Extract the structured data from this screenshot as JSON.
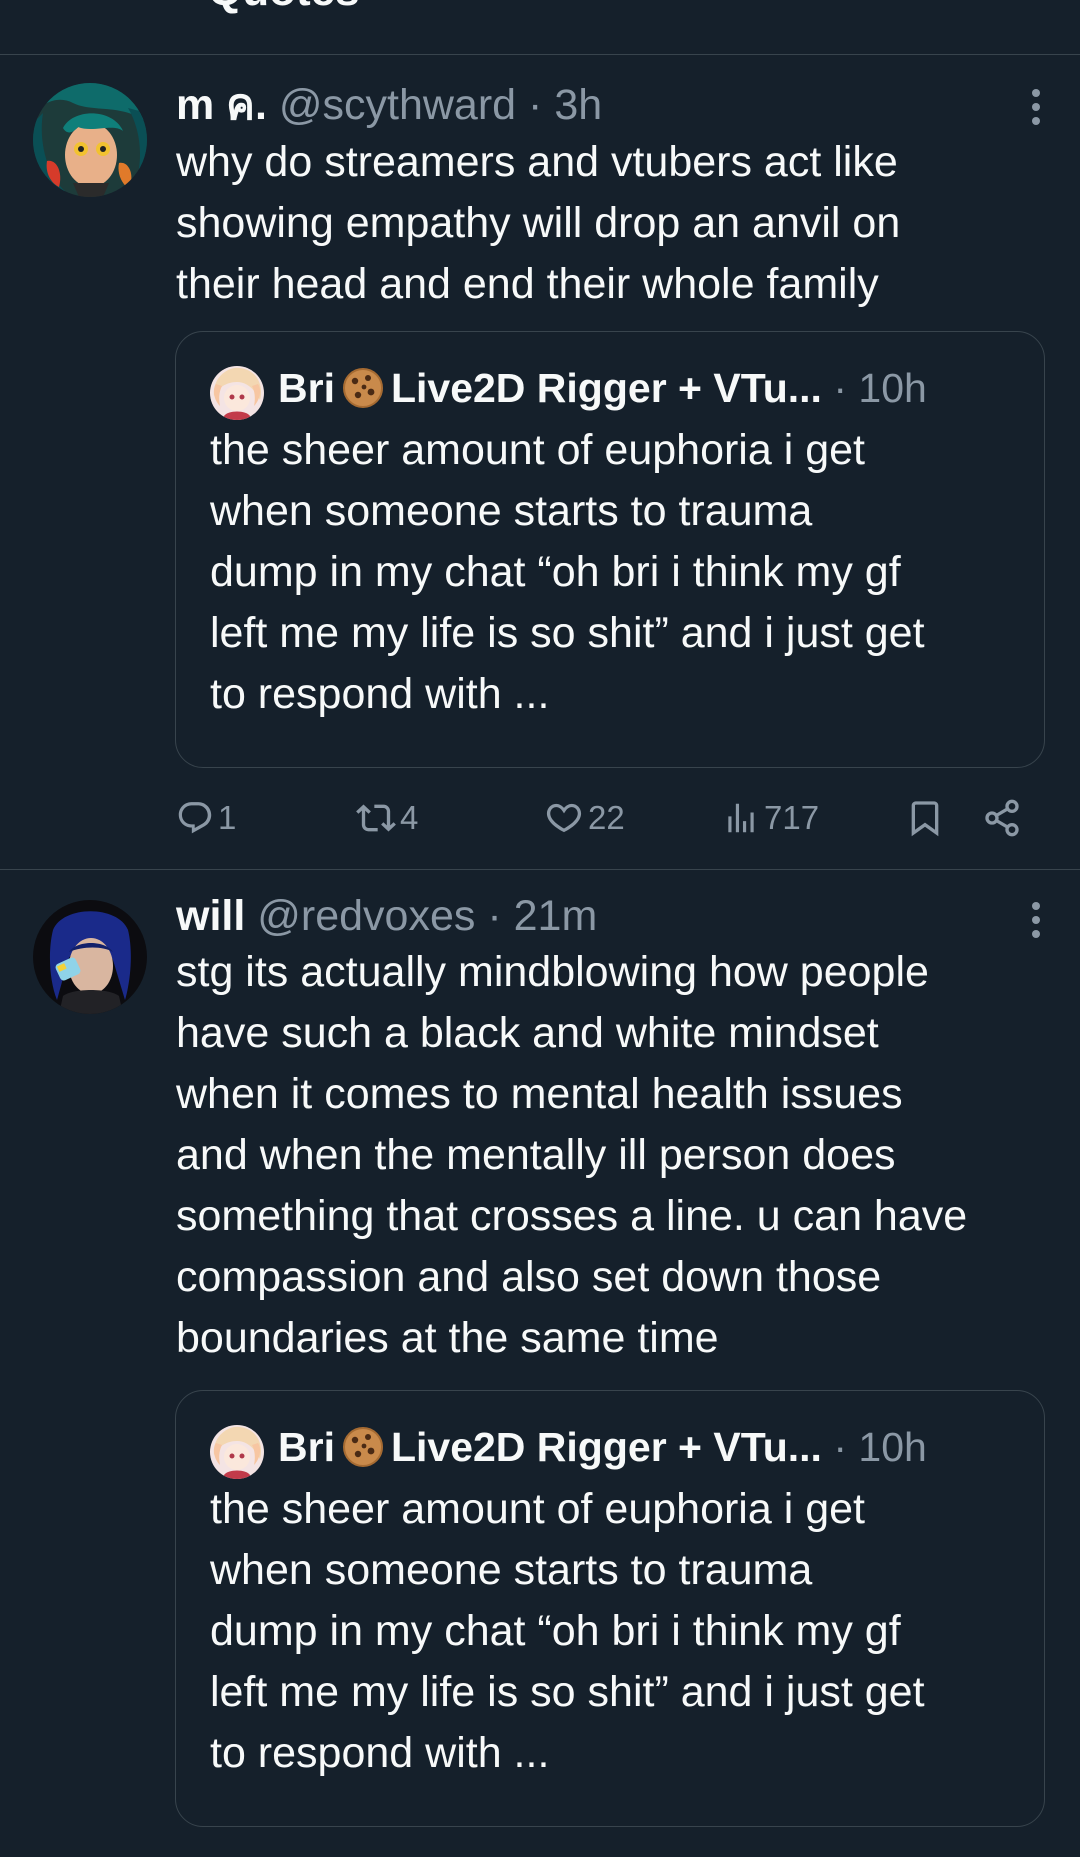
{
  "header": {
    "title": "Quotes"
  },
  "colors": {
    "background": "#15202b",
    "divider": "#38444d",
    "text_primary": "#f7f9f9",
    "text_secondary": "#8b98a5"
  },
  "tweets": [
    {
      "display_name": "m ค.",
      "handle": "@scythward",
      "separator": "·",
      "time": "3h",
      "text": "why do streamers and vtubers act like\nshowing empathy will drop an anvil on\ntheir head and end their whole family",
      "quote": {
        "display_name": "Bri",
        "emoji_icon": "cookie-icon",
        "display_name_suffix": "Live2D Rigger + VTu...",
        "separator": "·",
        "time": "10h",
        "text": "the sheer amount of euphoria i get\nwhen someone starts to trauma\ndump in my chat “oh bri i think my gf\nleft me my life is so shit” and i just get\nto respond with ..."
      },
      "actions": {
        "replies": "1",
        "reposts": "4",
        "likes": "22",
        "views": "717"
      }
    },
    {
      "display_name": "will",
      "handle": "@redvoxes",
      "separator": "·",
      "time": "21m",
      "text": "stg its actually mindblowing how people\nhave such a black and white mindset\nwhen it comes to mental health issues\nand when the mentally ill person does\nsomething that crosses a line. u can have\ncompassion and also set down those\nboundaries at the same time",
      "quote": {
        "display_name": "Bri",
        "emoji_icon": "cookie-icon",
        "display_name_suffix": "Live2D Rigger + VTu...",
        "separator": "·",
        "time": "10h",
        "text": "the sheer amount of euphoria i get\nwhen someone starts to trauma\ndump in my chat “oh bri i think my gf\nleft me my life is so shit” and i just get\nto respond with ..."
      }
    }
  ]
}
